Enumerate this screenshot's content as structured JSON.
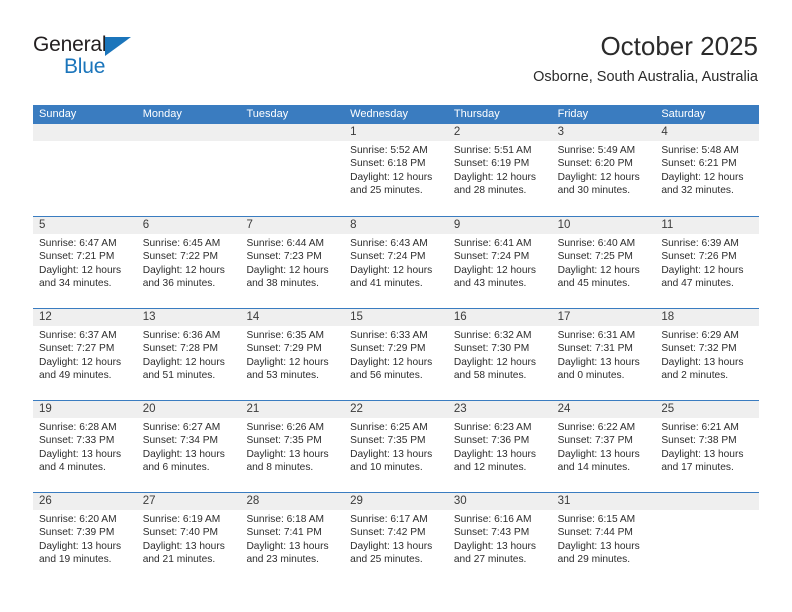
{
  "brand": {
    "name_part1": "General",
    "name_part2": "Blue",
    "accent_color": "#1b75bb",
    "triangle_icon": "triangle-icon"
  },
  "header": {
    "title": "October 2025",
    "subtitle": "Osborne, South Australia, Australia"
  },
  "calendar": {
    "header_bg": "#3a7cc0",
    "weekdays": [
      "Sunday",
      "Monday",
      "Tuesday",
      "Wednesday",
      "Thursday",
      "Friday",
      "Saturday"
    ],
    "weeks": [
      [
        {
          "day": "",
          "lines": []
        },
        {
          "day": "",
          "lines": []
        },
        {
          "day": "",
          "lines": []
        },
        {
          "day": "1",
          "lines": [
            "Sunrise: 5:52 AM",
            "Sunset: 6:18 PM",
            "Daylight: 12 hours",
            "and 25 minutes."
          ]
        },
        {
          "day": "2",
          "lines": [
            "Sunrise: 5:51 AM",
            "Sunset: 6:19 PM",
            "Daylight: 12 hours",
            "and 28 minutes."
          ]
        },
        {
          "day": "3",
          "lines": [
            "Sunrise: 5:49 AM",
            "Sunset: 6:20 PM",
            "Daylight: 12 hours",
            "and 30 minutes."
          ]
        },
        {
          "day": "4",
          "lines": [
            "Sunrise: 5:48 AM",
            "Sunset: 6:21 PM",
            "Daylight: 12 hours",
            "and 32 minutes."
          ]
        }
      ],
      [
        {
          "day": "5",
          "lines": [
            "Sunrise: 6:47 AM",
            "Sunset: 7:21 PM",
            "Daylight: 12 hours",
            "and 34 minutes."
          ]
        },
        {
          "day": "6",
          "lines": [
            "Sunrise: 6:45 AM",
            "Sunset: 7:22 PM",
            "Daylight: 12 hours",
            "and 36 minutes."
          ]
        },
        {
          "day": "7",
          "lines": [
            "Sunrise: 6:44 AM",
            "Sunset: 7:23 PM",
            "Daylight: 12 hours",
            "and 38 minutes."
          ]
        },
        {
          "day": "8",
          "lines": [
            "Sunrise: 6:43 AM",
            "Sunset: 7:24 PM",
            "Daylight: 12 hours",
            "and 41 minutes."
          ]
        },
        {
          "day": "9",
          "lines": [
            "Sunrise: 6:41 AM",
            "Sunset: 7:24 PM",
            "Daylight: 12 hours",
            "and 43 minutes."
          ]
        },
        {
          "day": "10",
          "lines": [
            "Sunrise: 6:40 AM",
            "Sunset: 7:25 PM",
            "Daylight: 12 hours",
            "and 45 minutes."
          ]
        },
        {
          "day": "11",
          "lines": [
            "Sunrise: 6:39 AM",
            "Sunset: 7:26 PM",
            "Daylight: 12 hours",
            "and 47 minutes."
          ]
        }
      ],
      [
        {
          "day": "12",
          "lines": [
            "Sunrise: 6:37 AM",
            "Sunset: 7:27 PM",
            "Daylight: 12 hours",
            "and 49 minutes."
          ]
        },
        {
          "day": "13",
          "lines": [
            "Sunrise: 6:36 AM",
            "Sunset: 7:28 PM",
            "Daylight: 12 hours",
            "and 51 minutes."
          ]
        },
        {
          "day": "14",
          "lines": [
            "Sunrise: 6:35 AM",
            "Sunset: 7:29 PM",
            "Daylight: 12 hours",
            "and 53 minutes."
          ]
        },
        {
          "day": "15",
          "lines": [
            "Sunrise: 6:33 AM",
            "Sunset: 7:29 PM",
            "Daylight: 12 hours",
            "and 56 minutes."
          ]
        },
        {
          "day": "16",
          "lines": [
            "Sunrise: 6:32 AM",
            "Sunset: 7:30 PM",
            "Daylight: 12 hours",
            "and 58 minutes."
          ]
        },
        {
          "day": "17",
          "lines": [
            "Sunrise: 6:31 AM",
            "Sunset: 7:31 PM",
            "Daylight: 13 hours",
            "and 0 minutes."
          ]
        },
        {
          "day": "18",
          "lines": [
            "Sunrise: 6:29 AM",
            "Sunset: 7:32 PM",
            "Daylight: 13 hours",
            "and 2 minutes."
          ]
        }
      ],
      [
        {
          "day": "19",
          "lines": [
            "Sunrise: 6:28 AM",
            "Sunset: 7:33 PM",
            "Daylight: 13 hours",
            "and 4 minutes."
          ]
        },
        {
          "day": "20",
          "lines": [
            "Sunrise: 6:27 AM",
            "Sunset: 7:34 PM",
            "Daylight: 13 hours",
            "and 6 minutes."
          ]
        },
        {
          "day": "21",
          "lines": [
            "Sunrise: 6:26 AM",
            "Sunset: 7:35 PM",
            "Daylight: 13 hours",
            "and 8 minutes."
          ]
        },
        {
          "day": "22",
          "lines": [
            "Sunrise: 6:25 AM",
            "Sunset: 7:35 PM",
            "Daylight: 13 hours",
            "and 10 minutes."
          ]
        },
        {
          "day": "23",
          "lines": [
            "Sunrise: 6:23 AM",
            "Sunset: 7:36 PM",
            "Daylight: 13 hours",
            "and 12 minutes."
          ]
        },
        {
          "day": "24",
          "lines": [
            "Sunrise: 6:22 AM",
            "Sunset: 7:37 PM",
            "Daylight: 13 hours",
            "and 14 minutes."
          ]
        },
        {
          "day": "25",
          "lines": [
            "Sunrise: 6:21 AM",
            "Sunset: 7:38 PM",
            "Daylight: 13 hours",
            "and 17 minutes."
          ]
        }
      ],
      [
        {
          "day": "26",
          "lines": [
            "Sunrise: 6:20 AM",
            "Sunset: 7:39 PM",
            "Daylight: 13 hours",
            "and 19 minutes."
          ]
        },
        {
          "day": "27",
          "lines": [
            "Sunrise: 6:19 AM",
            "Sunset: 7:40 PM",
            "Daylight: 13 hours",
            "and 21 minutes."
          ]
        },
        {
          "day": "28",
          "lines": [
            "Sunrise: 6:18 AM",
            "Sunset: 7:41 PM",
            "Daylight: 13 hours",
            "and 23 minutes."
          ]
        },
        {
          "day": "29",
          "lines": [
            "Sunrise: 6:17 AM",
            "Sunset: 7:42 PM",
            "Daylight: 13 hours",
            "and 25 minutes."
          ]
        },
        {
          "day": "30",
          "lines": [
            "Sunrise: 6:16 AM",
            "Sunset: 7:43 PM",
            "Daylight: 13 hours",
            "and 27 minutes."
          ]
        },
        {
          "day": "31",
          "lines": [
            "Sunrise: 6:15 AM",
            "Sunset: 7:44 PM",
            "Daylight: 13 hours",
            "and 29 minutes."
          ]
        },
        {
          "day": "",
          "lines": []
        }
      ]
    ]
  }
}
